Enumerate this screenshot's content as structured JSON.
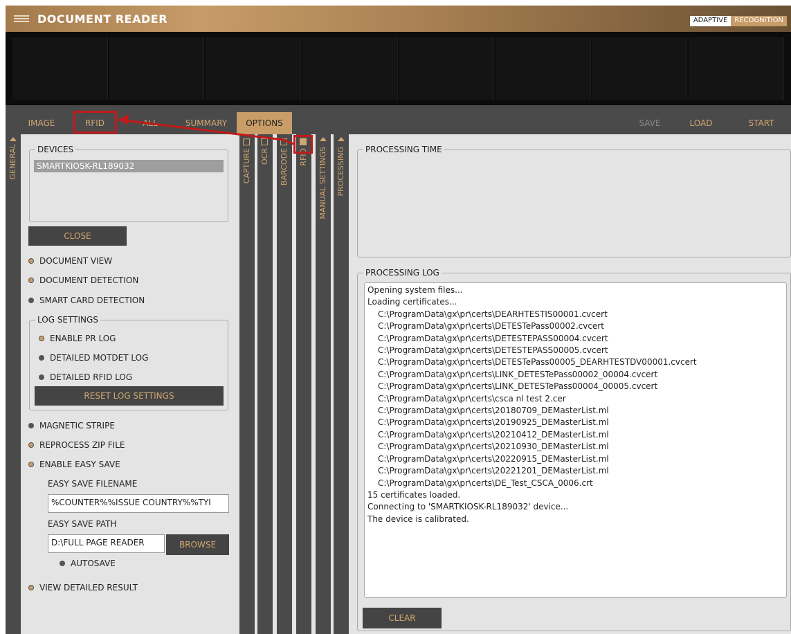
{
  "app": {
    "title": "DOCUMENT READER",
    "brand_adaptive": "ADAPTIVE",
    "brand_recognition": "RECOGNITION"
  },
  "tabs": [
    {
      "label": "IMAGE"
    },
    {
      "label": "RFID"
    },
    {
      "label": "ALL"
    },
    {
      "label": "SUMMARY"
    },
    {
      "label": "OPTIONS"
    }
  ],
  "actions": {
    "save": "SAVE",
    "load": "LOAD",
    "start": "START"
  },
  "side_strips": {
    "general": "GENERAL",
    "capture": "CAPTURE",
    "ocr": "OCR",
    "barcode": "BARCODE",
    "rfid": "RFID",
    "manual_settings": "MANUAL SETTINGS",
    "processing": "PROCESSING"
  },
  "general": {
    "devices_label": "DEVICES",
    "selected_device": "SMARTKIOSK-RL189032",
    "close_button": "CLOSE",
    "document_view": "DOCUMENT VIEW",
    "document_detection": "DOCUMENT DETECTION",
    "smart_card_detection": "SMART CARD DETECTION",
    "log_settings_label": "LOG SETTINGS",
    "enable_pr_log": "ENABLE PR LOG",
    "detailed_motdet_log": "DETAILED MOTDET LOG",
    "detailed_rfid_log": "DETAILED RFID LOG",
    "reset_log_settings": "RESET LOG SETTINGS",
    "magnetic_stripe": "MAGNETIC STRIPE",
    "reprocess_zip_file": "REPROCESS ZIP FILE",
    "enable_easy_save": "ENABLE EASY SAVE",
    "easy_save_filename_label": "EASY SAVE FILENAME",
    "easy_save_filename_value": "%COUNTER%%ISSUE COUNTRY%%TYI",
    "easy_save_path_label": "EASY SAVE PATH",
    "easy_save_path_value": "D:\\FULL PAGE READER",
    "browse_button": "BROWSE",
    "autosave": "AUTOSAVE",
    "view_detailed_result": "VIEW DETAILED RESULT"
  },
  "processing": {
    "time_label": "PROCESSING TIME",
    "log_label": "PROCESSING LOG",
    "clear_button": "CLEAR",
    "log_lines": [
      {
        "text": "Opening system files...",
        "indent": false
      },
      {
        "text": "Loading certificates...",
        "indent": false
      },
      {
        "text": "C:\\ProgramData\\gx\\pr\\certs\\DEARHTESTIS00001.cvcert",
        "indent": true
      },
      {
        "text": "C:\\ProgramData\\gx\\pr\\certs\\DETESTePass00002.cvcert",
        "indent": true
      },
      {
        "text": "C:\\ProgramData\\gx\\pr\\certs\\DETESTEPASS00004.cvcert",
        "indent": true
      },
      {
        "text": "C:\\ProgramData\\gx\\pr\\certs\\DETESTEPASS00005.cvcert",
        "indent": true
      },
      {
        "text": "C:\\ProgramData\\gx\\pr\\certs\\DETESTePass00005_DEARHTESTDV00001.cvcert",
        "indent": true
      },
      {
        "text": "C:\\ProgramData\\gx\\pr\\certs\\LINK_DETESTePass00002_00004.cvcert",
        "indent": true
      },
      {
        "text": "C:\\ProgramData\\gx\\pr\\certs\\LINK_DETESTePass00004_00005.cvcert",
        "indent": true
      },
      {
        "text": "C:\\ProgramData\\gx\\pr\\certs\\csca nl test 2.cer",
        "indent": true
      },
      {
        "text": "C:\\ProgramData\\gx\\pr\\certs\\20180709_DEMasterList.ml",
        "indent": true
      },
      {
        "text": "C:\\ProgramData\\gx\\pr\\certs\\20190925_DEMasterList.ml",
        "indent": true
      },
      {
        "text": "C:\\ProgramData\\gx\\pr\\certs\\20210412_DEMasterList.ml",
        "indent": true
      },
      {
        "text": "C:\\ProgramData\\gx\\pr\\certs\\20210930_DEMasterList.ml",
        "indent": true
      },
      {
        "text": "C:\\ProgramData\\gx\\pr\\certs\\20220915_DEMasterList.ml",
        "indent": true
      },
      {
        "text": "C:\\ProgramData\\gx\\pr\\certs\\20221201_DEMasterList.ml",
        "indent": true
      },
      {
        "text": "C:\\ProgramData\\gx\\pr\\certs\\DE_Test_CSCA_0006.crt",
        "indent": true
      },
      {
        "text": "15 certificates loaded.",
        "indent": false
      },
      {
        "text": "Connecting to 'SMARTKIOSK-RL189032' device...",
        "indent": false
      },
      {
        "text": "The device is calibrated.",
        "indent": false
      }
    ]
  },
  "colors": {
    "accent_gold": "#c99d67",
    "dark_panel": "#4a4a4a",
    "annotation_red": "#c21a1a"
  }
}
